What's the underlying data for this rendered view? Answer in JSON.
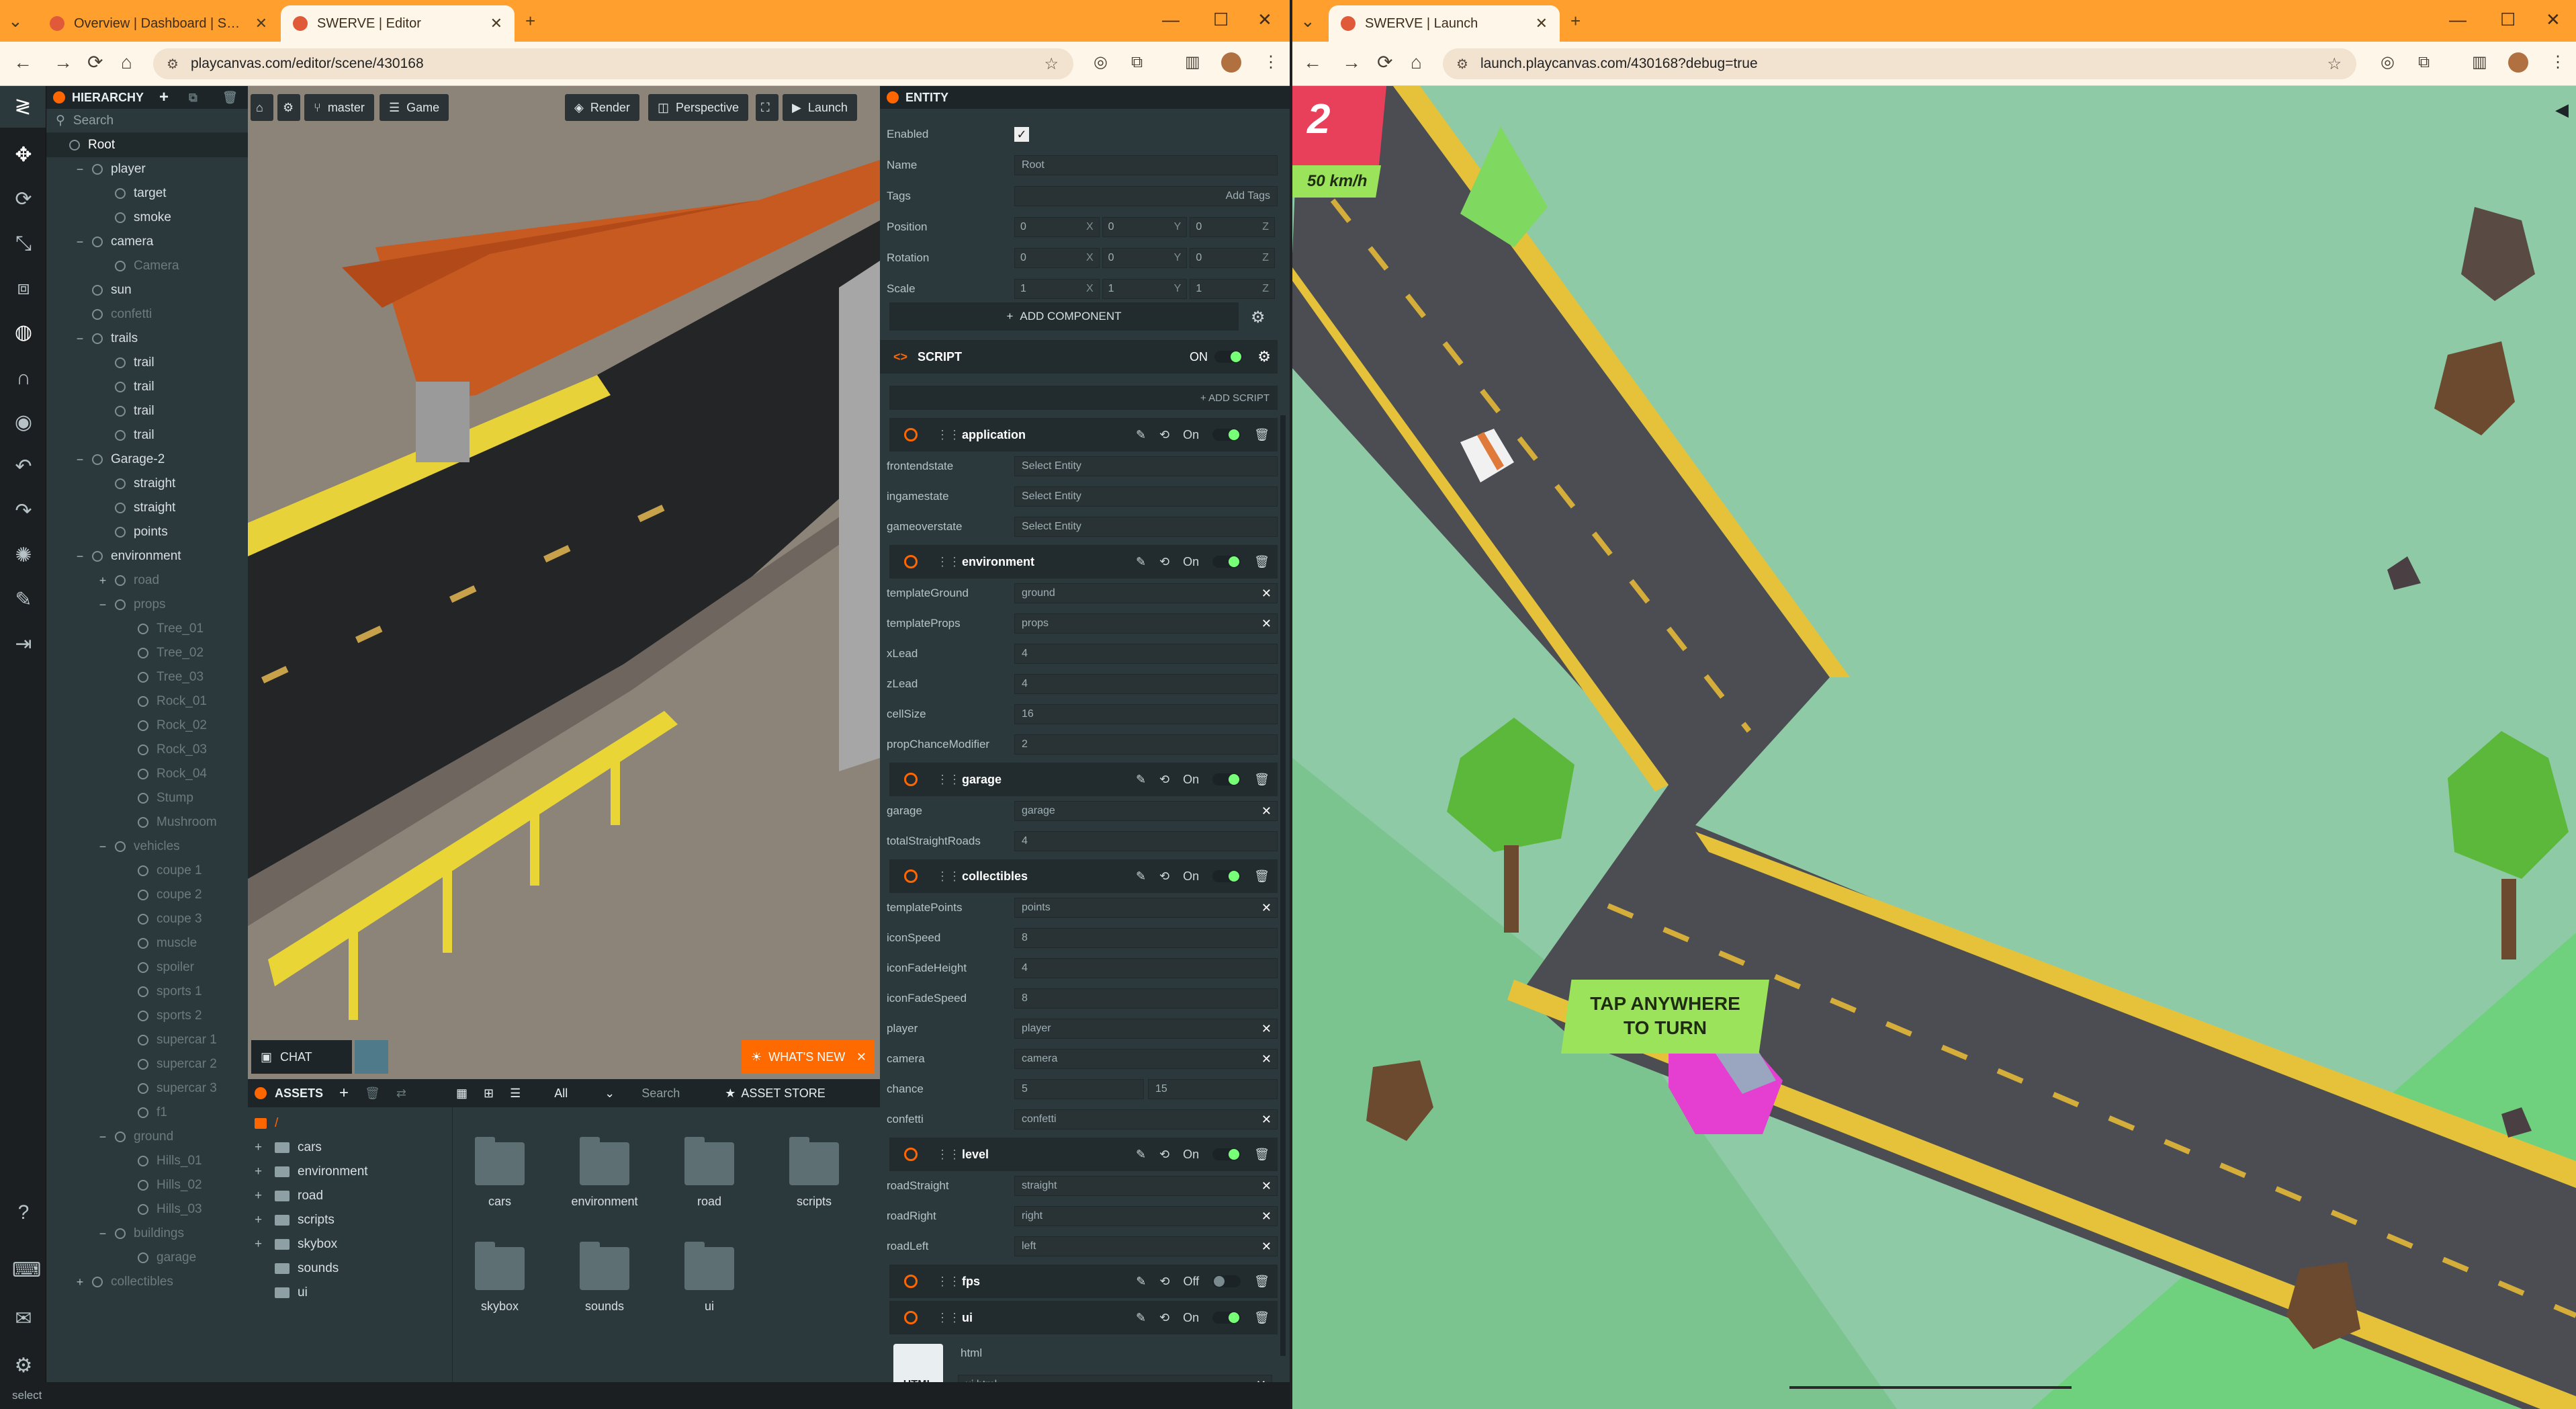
{
  "left_window": {
    "tabs": [
      {
        "title": "Overview | Dashboard | SWERVE"
      },
      {
        "title": "SWERVE | Editor"
      }
    ],
    "url": "playcanvas.com/editor/scene/430168",
    "hierarchy": {
      "title": "HIERARCHY",
      "search_placeholder": "Search",
      "items": [
        {
          "label": "Root",
          "depth": 0
        },
        {
          "label": "player",
          "depth": 1
        },
        {
          "label": "target",
          "depth": 2
        },
        {
          "label": "smoke",
          "depth": 2
        },
        {
          "label": "camera",
          "depth": 1
        },
        {
          "label": "Camera",
          "depth": 2
        },
        {
          "label": "sun",
          "depth": 1
        },
        {
          "label": "confetti",
          "depth": 1
        },
        {
          "label": "trails",
          "depth": 1
        },
        {
          "label": "trail",
          "depth": 2
        },
        {
          "label": "trail",
          "depth": 2
        },
        {
          "label": "trail",
          "depth": 2
        },
        {
          "label": "trail",
          "depth": 2
        },
        {
          "label": "Garage-2",
          "depth": 1
        },
        {
          "label": "straight",
          "depth": 2
        },
        {
          "label": "straight",
          "depth": 2
        },
        {
          "label": "points",
          "depth": 2
        },
        {
          "label": "environment",
          "depth": 1
        },
        {
          "label": "road",
          "depth": 2
        },
        {
          "label": "props",
          "depth": 2
        },
        {
          "label": "Tree_01",
          "depth": 3
        },
        {
          "label": "Tree_02",
          "depth": 3
        },
        {
          "label": "Tree_03",
          "depth": 3
        },
        {
          "label": "Rock_01",
          "depth": 3
        },
        {
          "label": "Rock_02",
          "depth": 3
        },
        {
          "label": "Rock_03",
          "depth": 3
        },
        {
          "label": "Rock_04",
          "depth": 3
        },
        {
          "label": "Stump",
          "depth": 3
        },
        {
          "label": "Mushroom",
          "depth": 3
        },
        {
          "label": "vehicles",
          "depth": 2
        },
        {
          "label": "coupe 1",
          "depth": 3
        },
        {
          "label": "coupe 2",
          "depth": 3
        },
        {
          "label": "coupe 3",
          "depth": 3
        },
        {
          "label": "muscle",
          "depth": 3
        },
        {
          "label": "spoiler",
          "depth": 3
        },
        {
          "label": "sports 1",
          "depth": 3
        },
        {
          "label": "sports 2",
          "depth": 3
        },
        {
          "label": "supercar 1",
          "depth": 3
        },
        {
          "label": "supercar 2",
          "depth": 3
        },
        {
          "label": "supercar 3",
          "depth": 3
        },
        {
          "label": "f1",
          "depth": 3
        },
        {
          "label": "ground",
          "depth": 2
        },
        {
          "label": "Hills_01",
          "depth": 3
        },
        {
          "label": "Hills_02",
          "depth": 3
        },
        {
          "label": "Hills_03",
          "depth": 3
        },
        {
          "label": "buildings",
          "depth": 2
        },
        {
          "label": "garage",
          "depth": 3
        },
        {
          "label": "collectibles",
          "depth": 1
        }
      ]
    },
    "viewport": {
      "branch": "master",
      "game": "Game",
      "render": "Render",
      "perspective": "Perspective",
      "launch": "Launch",
      "chat": "CHAT",
      "whats_new": "WHAT'S NEW"
    },
    "assets": {
      "title": "ASSETS",
      "filter": "All",
      "search": "Search",
      "store": "ASSET STORE",
      "root": "/",
      "folders": [
        "cars",
        "environment",
        "road",
        "scripts",
        "skybox",
        "sounds",
        "ui"
      ],
      "grid": [
        "cars",
        "environment",
        "road",
        "scripts",
        "skybox",
        "sounds",
        "ui"
      ]
    },
    "inspector": {
      "title": "ENTITY",
      "enabled_label": "Enabled",
      "name_label": "Name",
      "name_value": "Root",
      "tags_label": "Tags",
      "add_tags": "Add Tags",
      "position_label": "Position",
      "rotation_label": "Rotation",
      "scale_label": "Scale",
      "position": [
        "0",
        "0",
        "0"
      ],
      "rotation": [
        "0",
        "0",
        "0"
      ],
      "scale": [
        "1",
        "1",
        "1"
      ],
      "add_component": "ADD COMPONENT",
      "script_title": "SCRIPT",
      "script_on": "ON",
      "add_script": "+ ADD SCRIPT",
      "scripts": [
        {
          "name": "application",
          "state": "On",
          "attrs": [
            {
              "k": "frontendstate",
              "v": "Select Entity"
            },
            {
              "k": "ingamestate",
              "v": "Select Entity"
            },
            {
              "k": "gameoverstate",
              "v": "Select Entity"
            }
          ]
        },
        {
          "name": "environment",
          "state": "On",
          "attrs": [
            {
              "k": "templateGround",
              "v": "ground",
              "x": true
            },
            {
              "k": "templateProps",
              "v": "props",
              "x": true
            },
            {
              "k": "xLead",
              "v": "4"
            },
            {
              "k": "zLead",
              "v": "4"
            },
            {
              "k": "cellSize",
              "v": "16"
            },
            {
              "k": "propChanceModifier",
              "v": "2"
            }
          ]
        },
        {
          "name": "garage",
          "state": "On",
          "attrs": [
            {
              "k": "garage",
              "v": "garage",
              "x": true
            },
            {
              "k": "totalStraightRoads",
              "v": "4"
            }
          ]
        },
        {
          "name": "collectibles",
          "state": "On",
          "attrs": [
            {
              "k": "templatePoints",
              "v": "points",
              "x": true
            },
            {
              "k": "iconSpeed",
              "v": "8"
            },
            {
              "k": "iconFadeHeight",
              "v": "4"
            },
            {
              "k": "iconFadeSpeed",
              "v": "8"
            },
            {
              "k": "player",
              "v": "player",
              "x": true
            },
            {
              "k": "camera",
              "v": "camera",
              "x": true
            },
            {
              "k": "chance",
              "v": "5",
              "v2": "15"
            },
            {
              "k": "confetti",
              "v": "confetti",
              "x": true
            }
          ]
        },
        {
          "name": "level",
          "state": "On",
          "attrs": [
            {
              "k": "roadStraight",
              "v": "straight",
              "x": true
            },
            {
              "k": "roadRight",
              "v": "right",
              "x": true
            },
            {
              "k": "roadLeft",
              "v": "left",
              "x": true
            }
          ]
        },
        {
          "name": "fps",
          "state": "Off",
          "attrs": []
        },
        {
          "name": "ui",
          "state": "On",
          "attrs": []
        }
      ],
      "ui_html_label": "html",
      "ui_html_icon": "HTML",
      "ui_html_file": "ui.html"
    },
    "status": "select"
  },
  "right_window": {
    "tab_title": "SWERVE | Launch",
    "url": "launch.playcanvas.com/430168?debug=true",
    "game": {
      "score": "2",
      "speed": "50 km/h",
      "hint_line1": "TAP ANYWHERE",
      "hint_line2": "TO TURN"
    }
  },
  "colors": {
    "browser_frame": "#ff9f2e",
    "editor_panel": "#2c393c",
    "accent": "#ff6600",
    "score_badge": "#e8405a",
    "speed_badge": "#9be35a",
    "grass": "#8fcaa6"
  }
}
